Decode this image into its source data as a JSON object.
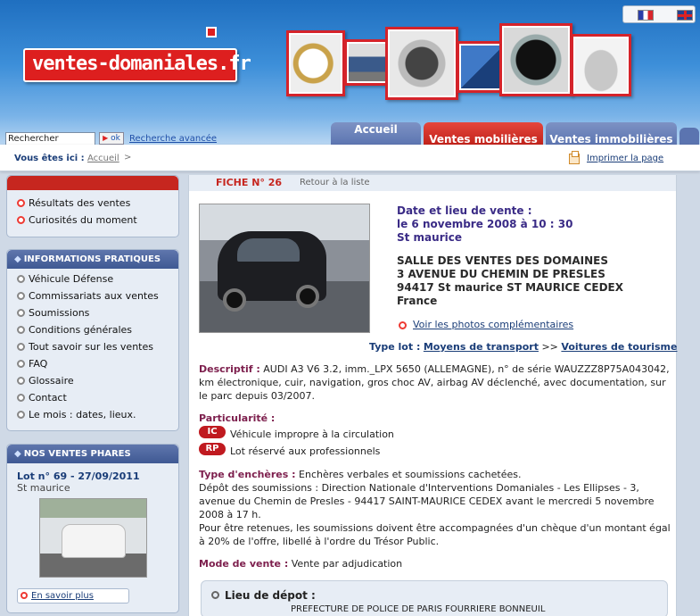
{
  "header": {
    "logo_text": "ventes-domaniales.fr",
    "search": {
      "placeholder": "Rechercher",
      "button_label": "ok",
      "advanced_link": "Recherche avancée"
    },
    "tabs": [
      {
        "label": "Accueil"
      },
      {
        "label": "Ventes mobilières"
      },
      {
        "label": "Ventes immobilières"
      }
    ]
  },
  "breadcrumb": {
    "label": "Vous êtes ici :",
    "home": "Accueil",
    "sep": ">",
    "print_link": "Imprimer la page"
  },
  "sidebar": {
    "quick_links": [
      {
        "label": "Résultats des ventes"
      },
      {
        "label": "Curiosités du moment"
      }
    ],
    "info_title": "INFORMATIONS PRATIQUES",
    "info_items": [
      {
        "label": "Véhicule Défense"
      },
      {
        "label": "Commissariats aux ventes"
      },
      {
        "label": "Soumissions"
      },
      {
        "label": "Conditions générales"
      },
      {
        "label": "Tout savoir sur les ventes"
      },
      {
        "label": "FAQ"
      },
      {
        "label": "Glossaire"
      },
      {
        "label": "Contact"
      },
      {
        "label": "Le mois : dates, lieux."
      }
    ],
    "phares": {
      "title": "NOS VENTES PHARES",
      "lot": "Lot n° 69 - 27/09/2011",
      "place": "St maurice",
      "more": "En savoir plus"
    }
  },
  "fiche": {
    "label": "FICHE N° 26",
    "back": "Retour à la liste"
  },
  "sale": {
    "date_title": "Date et lieu de vente :",
    "date": "le 6 novembre 2008 à 10 : 30",
    "city": "St maurice",
    "venue": "SALLE DES VENTES DES DOMAINES",
    "street": "3 AVENUE DU CHEMIN DE PRESLES",
    "postal": "94417 St maurice ST MAURICE CEDEX",
    "country": "France",
    "photos_link": "Voir les photos complémentaires",
    "typelot_label": "Type lot :",
    "typelot_cat": "Moyens de transport",
    "typelot_sep": ">>",
    "typelot_sub": "Voitures de tourisme"
  },
  "details": {
    "descriptif_label": "Descriptif :",
    "descriptif": "AUDI A3 V6 3.2, imm._LPX 5650 (ALLEMAGNE), n° de série WAUZZZ8P75A043042, km électronique, cuir, navigation, gros choc AV, airbag AV déclenché, avec documentation, sur le parc depuis 03/2007.",
    "particularite_label": "Particularité :",
    "tags": [
      {
        "code": "IC",
        "text": "Véhicule impropre à la circulation"
      },
      {
        "code": "RP",
        "text": "Lot réservé aux professionnels"
      }
    ],
    "encheres_label": "Type d'enchères :",
    "encheres": "Enchères verbales et soumissions cachetées.",
    "depot_soumissions": "Dépôt des soumissions : Direction Nationale d'Interventions Domaniales - Les Ellipses - 3, avenue du Chemin de Presles - 94417 SAINT-MAURICE CEDEX avant le mercredi 5 novembre 2008 à 17 h.",
    "cheque": "Pour être retenues, les soumissions doivent être accompagnées d'un chèque d'un montant égal à 20% de l'offre, libellé à l'ordre du Trésor Public.",
    "mode_label": "Mode de vente :",
    "mode": "Vente par adjudication",
    "depot_label": "Lieu de dépot :",
    "depot_value": "PREFECTURE DE POLICE DE PARIS FOURRIERE BONNEUIL"
  }
}
